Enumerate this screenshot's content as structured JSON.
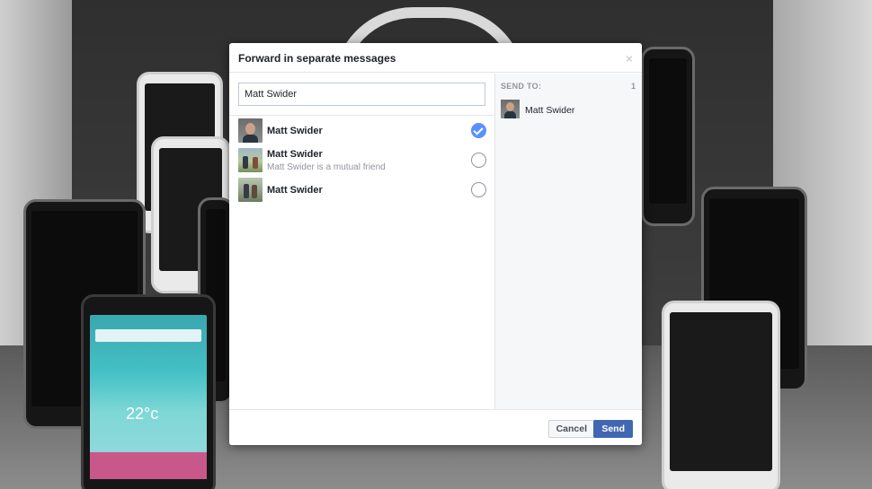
{
  "dialog": {
    "title": "Forward in separate messages",
    "close_icon": "close-icon",
    "close_glyph": "×"
  },
  "search": {
    "value": "Matt Swider"
  },
  "results": [
    {
      "name": "Matt Swider",
      "subtitle": "",
      "selected": true
    },
    {
      "name": "Matt Swider",
      "subtitle": "Matt Swider is a mutual friend",
      "selected": false
    },
    {
      "name": "Matt Swider",
      "subtitle": "",
      "selected": false
    }
  ],
  "send_to": {
    "label": "SEND TO:",
    "count": "1",
    "recipients": [
      {
        "name": "Matt Swider"
      }
    ]
  },
  "footer": {
    "cancel_label": "Cancel",
    "send_label": "Send"
  },
  "background": {
    "lg_temperature": "22°c"
  },
  "colors": {
    "accent": "#5890ff",
    "send_button": "#4267b2"
  }
}
